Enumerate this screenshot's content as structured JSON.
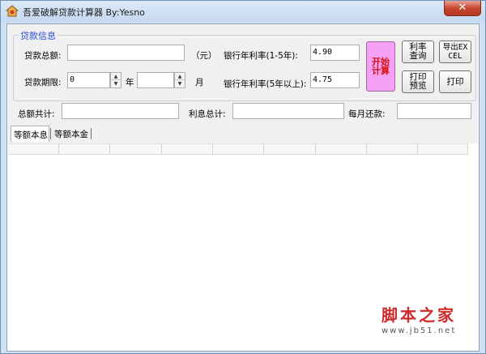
{
  "window": {
    "title": "吾爱破解贷款计算器 By:Yesno",
    "close_label": "✕"
  },
  "loan_group": {
    "label": "贷款信息",
    "total_label": "贷款总额:",
    "total_value": "",
    "unit_label": "（元）",
    "term_label": "贷款期限:",
    "years_value": "0",
    "years_unit": "年",
    "months_value": "",
    "months_unit": "月",
    "rate_short_label": "银行年利率(1-5年):",
    "rate_short_value": "4.90",
    "rate_long_label": "银行年利率(5年以上):",
    "rate_long_value": "4.75"
  },
  "buttons": {
    "start": "开始计算",
    "rate_query": "利率查询",
    "export_excel": "导出EXCEL",
    "print_preview": "打印预览",
    "print": "打印"
  },
  "summary": {
    "total_label": "总额共计:",
    "total_value": "",
    "interest_label": "利息总计:",
    "interest_value": "",
    "monthly_label": "每月还款:",
    "monthly_value": ""
  },
  "tabs": [
    {
      "label": "等额本息",
      "active": true
    },
    {
      "label": "等额本金",
      "active": false
    }
  ],
  "watermark": {
    "main": "脚本之家",
    "sub": "www.jb51.net"
  }
}
